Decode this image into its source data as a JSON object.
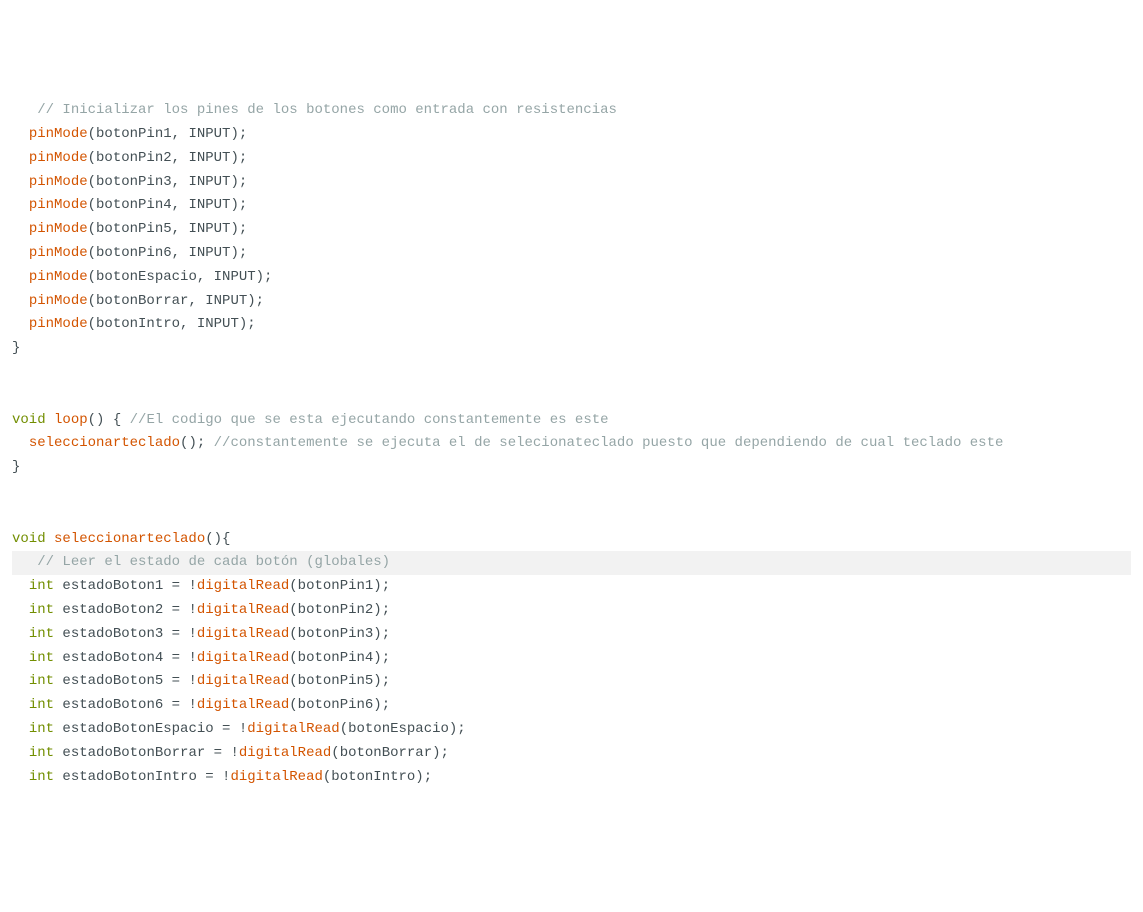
{
  "code": {
    "comment1": "// Inicializar los pines de los botones como entrada con resistencias",
    "pinMode": "pinMode",
    "botonPin1": "(botonPin1, INPUT);",
    "botonPin2": "(botonPin2, INPUT);",
    "botonPin3": "(botonPin3, INPUT);",
    "botonPin4": "(botonPin4, INPUT);",
    "botonPin5": "(botonPin5, INPUT);",
    "botonPin6": "(botonPin6, INPUT);",
    "botonEspacio": "(botonEspacio, INPUT);",
    "botonBorrar": "(botonBorrar, INPUT);",
    "botonIntro": "(botonIntro, INPUT);",
    "closeBrace": "}",
    "void": "void",
    "loop": " loop",
    "loopParen": "() { ",
    "loopComment": "//El codigo que se esta ejecutando constantemente es este",
    "seleccionarteclado": "seleccionarteclado",
    "selCall": "(); ",
    "selComment": "//constantemente se ejecuta el de selecionateclado puesto que dependiendo de cual teclado este",
    "funcDef": " seleccionarteclado",
    "funcParen": "(){",
    "comment2": "// Leer el estado de cada botón (globales)",
    "int": "int",
    "digitalRead": "digitalRead",
    "estado1a": " estadoBoton1 = !",
    "estado1b": "(botonPin1);",
    "estado2a": " estadoBoton2 = !",
    "estado2b": "(botonPin2);",
    "estado3a": " estadoBoton3 = !",
    "estado3b": "(botonPin3);",
    "estado4a": " estadoBoton4 = !",
    "estado4b": "(botonPin4);",
    "estado5a": " estadoBoton5 = !",
    "estado5b": "(botonPin5);",
    "estado6a": " estadoBoton6 = !",
    "estado6b": "(botonPin6);",
    "estadoEspA": " estadoBotonEspacio = !",
    "estadoEspB": "(botonEspacio);",
    "estadoBorA": " estadoBotonBorrar = !",
    "estadoBorB": "(botonBorrar);",
    "estadoIntA": " estadoBotonIntro = !",
    "estadoIntB": "(botonIntro);"
  }
}
